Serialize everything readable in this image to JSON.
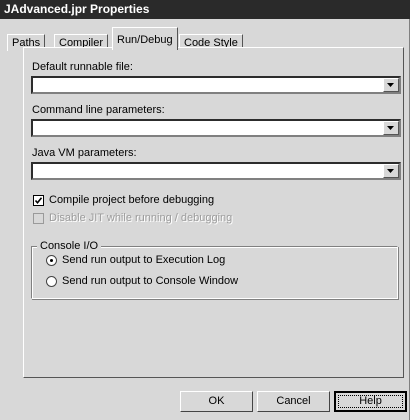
{
  "window": {
    "title": "JAdvanced.jpr Properties"
  },
  "tabs": [
    {
      "label": "Paths"
    },
    {
      "label": "Compiler"
    },
    {
      "label": "Run/Debug",
      "active": true
    },
    {
      "label": "Code Style"
    }
  ],
  "fields": {
    "default_runnable": {
      "label": "Default runnable file:",
      "value": ""
    },
    "command_line": {
      "label": "Command line parameters:",
      "value": ""
    },
    "java_vm": {
      "label": "Java VM parameters:",
      "value": ""
    }
  },
  "options": {
    "compile_before_debug": {
      "label": "Compile project before debugging",
      "checked": true
    },
    "disable_jit": {
      "label": "Disable JIT while running / debugging",
      "checked": false,
      "disabled": true
    }
  },
  "console_io": {
    "title": "Console I/O",
    "execution_log": {
      "label": "Send run output to Execution Log",
      "selected": true
    },
    "console_window": {
      "label": "Send run output to Console Window",
      "selected": false
    }
  },
  "buttons": {
    "ok": "OK",
    "cancel": "Cancel",
    "help": "Help"
  },
  "colors": {
    "titlebar": "#2a2a2a",
    "face": "#d8d8d8"
  }
}
